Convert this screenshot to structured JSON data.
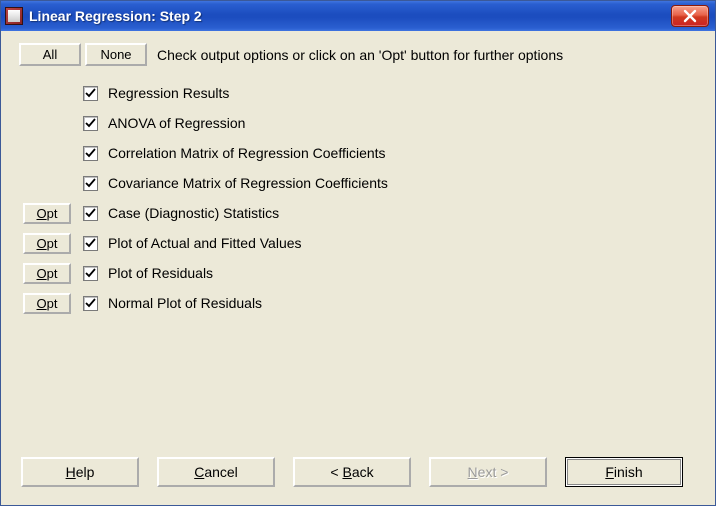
{
  "title": "Linear Regression: Step 2",
  "buttons": {
    "all": "All",
    "none": "None",
    "opt": "Opt",
    "help": "Help",
    "cancel": "Cancel",
    "back": "Back",
    "next": "Next",
    "finish": "Finish",
    "back_prefix": "< ",
    "next_suffix": " >"
  },
  "instruction": "Check output options or click on an 'Opt' button for further options",
  "options": [
    {
      "label": "Regression Results",
      "checked": true,
      "has_opt": false
    },
    {
      "label": "ANOVA of Regression",
      "checked": true,
      "has_opt": false
    },
    {
      "label": "Correlation Matrix of Regression Coefficients",
      "checked": true,
      "has_opt": false
    },
    {
      "label": "Covariance Matrix of Regression Coefficients",
      "checked": true,
      "has_opt": false
    },
    {
      "label": "Case (Diagnostic) Statistics",
      "checked": true,
      "has_opt": true
    },
    {
      "label": "Plot of Actual and Fitted Values",
      "checked": true,
      "has_opt": true
    },
    {
      "label": "Plot of Residuals",
      "checked": true,
      "has_opt": true
    },
    {
      "label": "Normal Plot of Residuals",
      "checked": true,
      "has_opt": true
    }
  ]
}
